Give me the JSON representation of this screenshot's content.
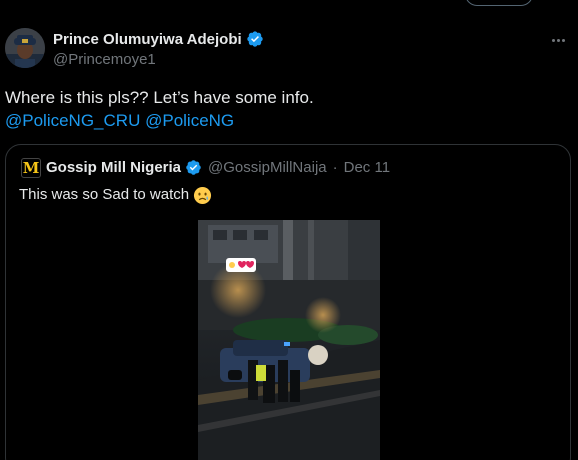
{
  "tweet": {
    "author_name": "Prince Olumuyiwa Adejobi",
    "author_handle": "@Princemoye1",
    "text": "Where is this pls?? Let’s have some info.",
    "mention_1": "@PoliceNG_CRU",
    "mention_2": "@PoliceNG"
  },
  "quote": {
    "author_name": "Gossip Mill Nigeria",
    "author_handle": "@GossipMillNaija",
    "separator": "·",
    "date": "Dec 11",
    "text": "This was so Sad to watch",
    "logo_letter": "M"
  },
  "icons": {
    "verified": "verified-badge-icon",
    "more": "more-options-icon",
    "emoji": "sad-face-emoji-icon"
  },
  "colors": {
    "background": "#000000",
    "text": "#e7e9ea",
    "muted": "#71767b",
    "accent": "#1d9bf0",
    "border": "#2f3336"
  }
}
